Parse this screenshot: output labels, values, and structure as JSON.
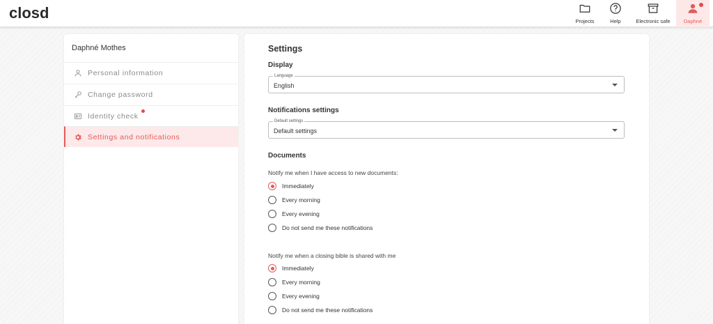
{
  "brand": {
    "logo_text": "closd",
    "accent": "#e45a5a"
  },
  "header": {
    "nav": [
      {
        "label": "Projects",
        "icon": "folder-icon"
      },
      {
        "label": "Help",
        "icon": "help-icon"
      },
      {
        "label": "Electronic safe",
        "icon": "archive-icon"
      },
      {
        "label": "Daphné",
        "icon": "user-icon",
        "active": true,
        "notification": true
      }
    ]
  },
  "sidebar": {
    "user_name": "Daphné Mothes",
    "items": [
      {
        "label": "Personal information",
        "icon": "user-outline-icon"
      },
      {
        "label": "Change password",
        "icon": "key-icon"
      },
      {
        "label": "Identity check",
        "icon": "id-card-icon",
        "notification": true
      },
      {
        "label": "Settings and notifications",
        "icon": "gear-icon",
        "active": true
      }
    ]
  },
  "main": {
    "title": "Settings",
    "display": {
      "heading": "Display",
      "language_label": "Language",
      "language_value": "English"
    },
    "notifications": {
      "heading": "Notifications settings",
      "default_label": "Default settings",
      "default_value": "Default settings"
    },
    "documents": {
      "heading": "Documents",
      "q1": {
        "text": "Notify me when I have access to new documents:",
        "options": [
          "Immediately",
          "Every morning",
          "Every evening",
          "Do not send me these notifications"
        ],
        "selected": "Immediately"
      },
      "q2": {
        "text": "Notify me when a closing bible is shared with me",
        "options": [
          "Immediately",
          "Every morning",
          "Every evening",
          "Do not send me these notifications"
        ],
        "selected": "Immediately"
      }
    }
  }
}
